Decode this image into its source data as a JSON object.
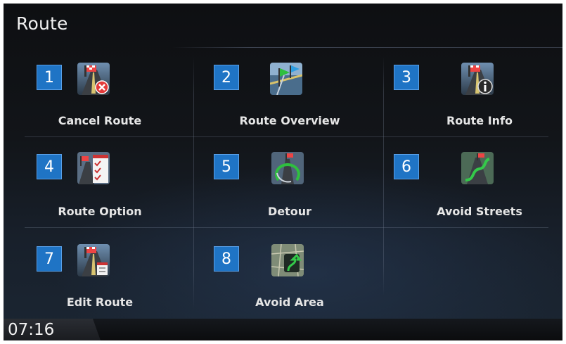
{
  "header": {
    "title": "Route"
  },
  "menu": {
    "items": [
      {
        "number": "1",
        "label": "Cancel Route",
        "icon": "cancel-route-icon"
      },
      {
        "number": "2",
        "label": "Route Overview",
        "icon": "route-overview-icon"
      },
      {
        "number": "3",
        "label": "Route Info",
        "icon": "route-info-icon"
      },
      {
        "number": "4",
        "label": "Route Option",
        "icon": "route-option-icon"
      },
      {
        "number": "5",
        "label": "Detour",
        "icon": "detour-icon"
      },
      {
        "number": "6",
        "label": "Avoid Streets",
        "icon": "avoid-streets-icon"
      },
      {
        "number": "7",
        "label": "Edit Route",
        "icon": "edit-route-icon"
      },
      {
        "number": "8",
        "label": "Avoid Area",
        "icon": "avoid-area-icon"
      }
    ]
  },
  "status_bar": {
    "time": "07:16"
  },
  "colors": {
    "badge": "#1f74c5",
    "background": "#121519",
    "text": "#e6e6e6"
  }
}
